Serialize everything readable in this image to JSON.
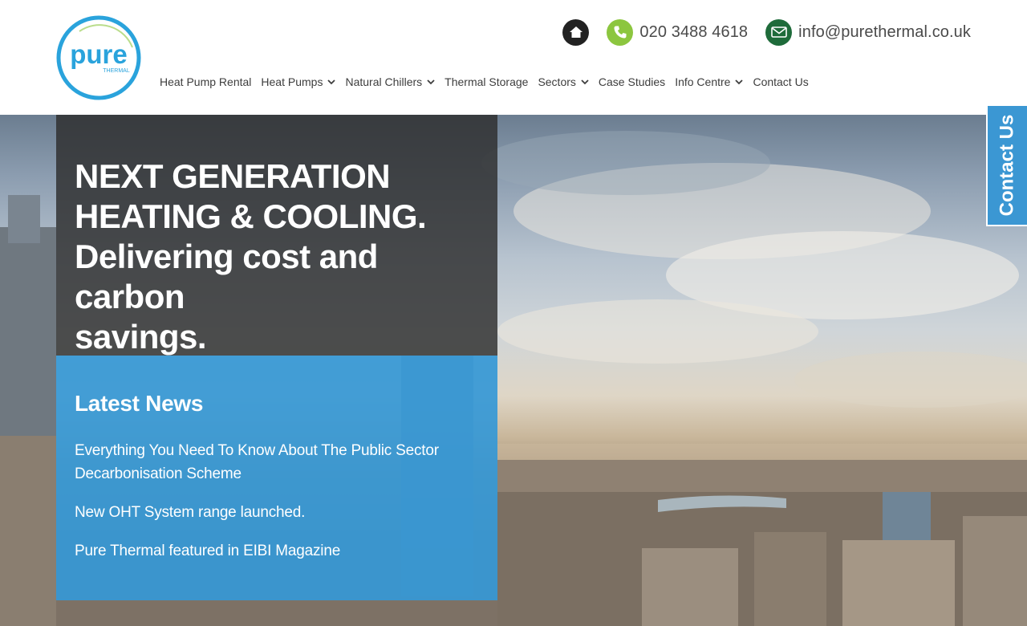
{
  "brand": {
    "logo_word": "pure",
    "logo_sub": "THERMAL",
    "ring_color": "#2aa3dc",
    "text_color": "#2aa3dc"
  },
  "contact": {
    "phone": "020 3488 4618",
    "email": "info@purethermal.co.uk",
    "icons": [
      "home-icon",
      "phone-icon",
      "email-icon"
    ],
    "home_color": "#222222",
    "phone_color": "#8cc63f",
    "email_color": "#1e6b3a"
  },
  "nav": {
    "items": [
      {
        "label": "Heat Pump Rental",
        "dropdown": false
      },
      {
        "label": "Heat Pumps",
        "dropdown": true
      },
      {
        "label": "Natural Chillers",
        "dropdown": true
      },
      {
        "label": "Thermal Storage",
        "dropdown": false
      },
      {
        "label": "Sectors",
        "dropdown": true
      },
      {
        "label": "Case Studies",
        "dropdown": false
      },
      {
        "label": "Info Centre",
        "dropdown": true
      },
      {
        "label": "Contact Us",
        "dropdown": false
      }
    ]
  },
  "hero": {
    "headline_line1": "NEXT GENERATION",
    "headline_line2": "HEATING & COOLING.",
    "headline_line3": "Delivering cost and carbon",
    "headline_line4": "savings."
  },
  "news": {
    "title": "Latest News",
    "items": [
      "Everything You Need To Know About The Public Sector Decarbonisation Scheme",
      "New OHT System range launched.",
      "Pure Thermal featured in EIBI Magazine"
    ]
  },
  "side_tab": {
    "label": "Contact Us",
    "color": "#3b97d3"
  }
}
